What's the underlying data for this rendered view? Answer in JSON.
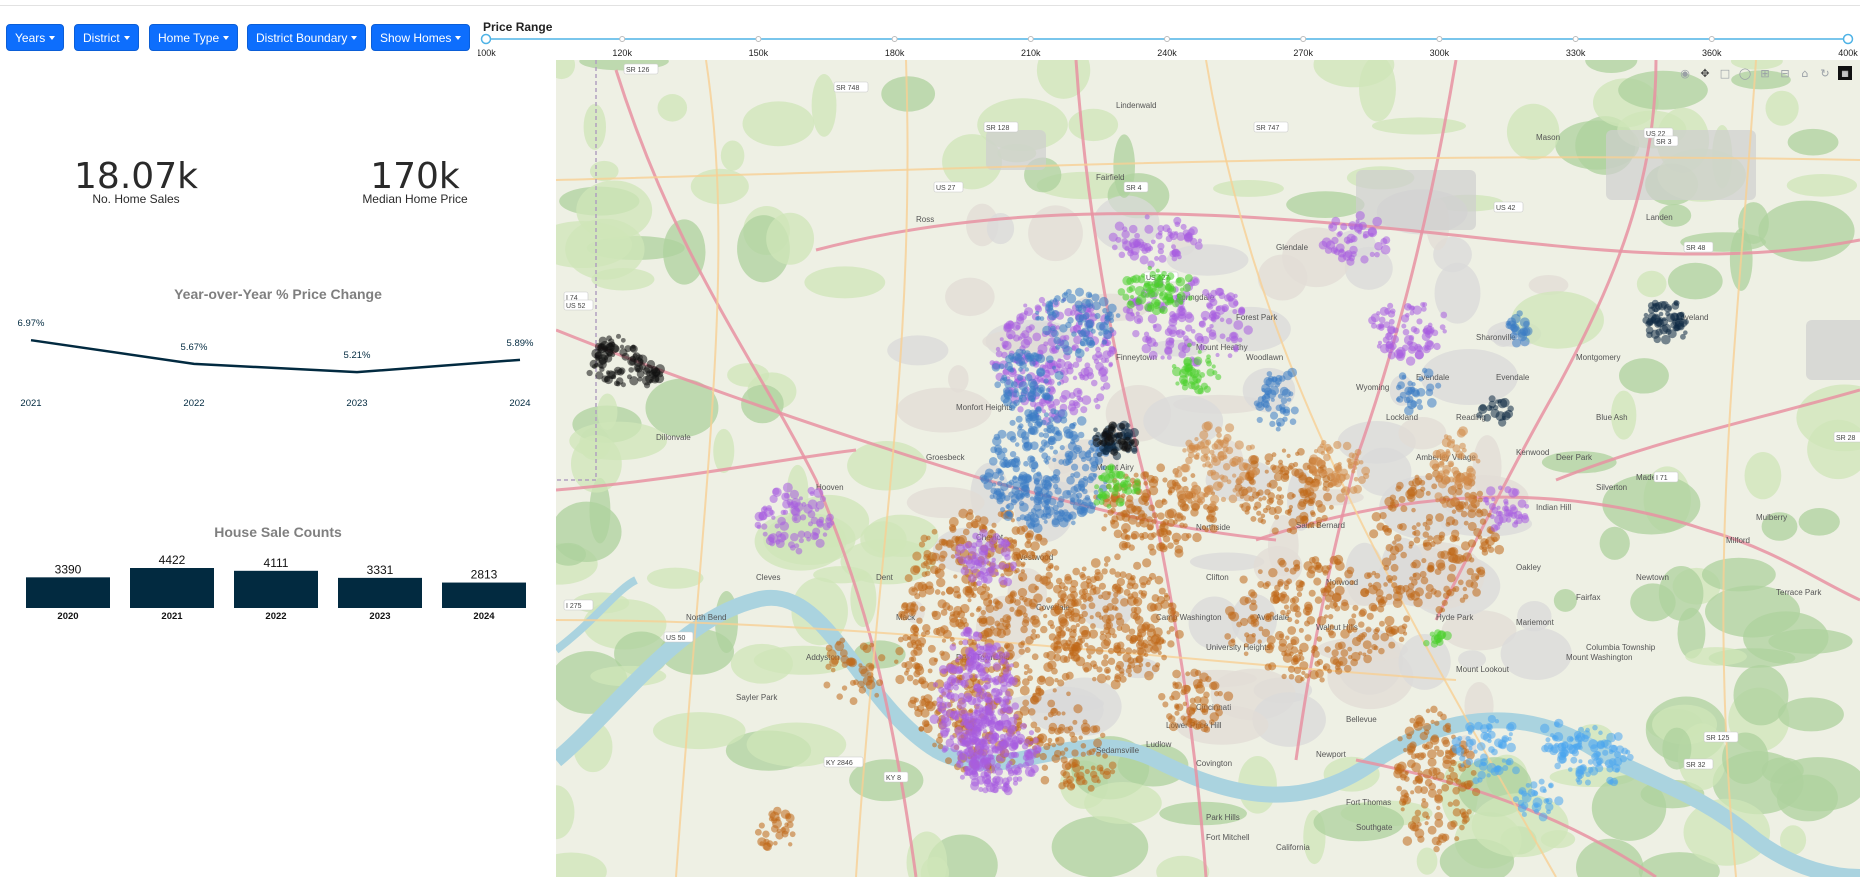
{
  "toolbar": {
    "filters": [
      {
        "label": "Years"
      },
      {
        "label": "District"
      },
      {
        "label": "Home Type"
      },
      {
        "label": "District Boundary"
      },
      {
        "label": "Show Homes"
      }
    ],
    "accent": "#0d6efd"
  },
  "price_range": {
    "title": "Price Range",
    "ticks": [
      "100k",
      "120k",
      "150k",
      "180k",
      "210k",
      "240k",
      "270k",
      "300k",
      "330k",
      "360k",
      "400k"
    ],
    "selected_min": "100k",
    "selected_max": "400k",
    "track_color": "#4fb3e6"
  },
  "kpis": {
    "home_sales_value": "18.07k",
    "home_sales_label": "No. Home Sales",
    "median_price_value": "170k",
    "median_price_label": "Median Home Price"
  },
  "charts": {
    "yoy_title": "Year-over-Year % Price Change",
    "counts_title": "House Sale Counts",
    "bar_color": "#022a40"
  },
  "chart_data": [
    {
      "type": "line",
      "title": "Year-over-Year % Price Change",
      "x": [
        "2021",
        "2022",
        "2023",
        "2024"
      ],
      "values": [
        6.97,
        5.67,
        5.21,
        5.89
      ],
      "labels": [
        "6.97%",
        "5.67%",
        "5.21%",
        "5.89%"
      ]
    },
    {
      "type": "bar",
      "title": "House Sale Counts",
      "categories": [
        "2020",
        "2021",
        "2022",
        "2023",
        "2024"
      ],
      "values": [
        3390,
        4422,
        4111,
        3331,
        2813
      ]
    }
  ],
  "map": {
    "place_labels": [
      "Fairfield",
      "Lindenwald",
      "Mason",
      "Ross",
      "Sharonville",
      "Evendale",
      "Amberley Village",
      "Kenwood",
      "Indian Hill",
      "Milford",
      "Terrace Park",
      "Norwood",
      "Saint Bernard",
      "University Heights",
      "Cincinnati",
      "Newport",
      "Covington",
      "Bellevue",
      "Ludlow",
      "Fort Thomas",
      "Mariemont",
      "Mount Lookout",
      "Sedamsville",
      "Lower Price Hill",
      "North Bend",
      "Cleves",
      "Hooven",
      "Park Hills",
      "Fort Mitchell",
      "Southgate",
      "California",
      "Mount Washington",
      "Wyoming",
      "Lockland",
      "Camp Washington",
      "Landen",
      "Loveland",
      "Silverton",
      "Mulberry",
      "Sayler Park",
      "Addyston",
      "Dent",
      "Mack",
      "Monfort Heights",
      "Groesbeck",
      "Springdale",
      "Forest Park",
      "Mount Healthy",
      "Finneytown",
      "Woodlawn",
      "Glendale",
      "Evendale",
      "Montgomery",
      "Blue Ash",
      "Reading",
      "Deer Park",
      "Madeira",
      "Newtown",
      "Fairfax",
      "Columbia Township",
      "Oakley",
      "Hyde Park",
      "Walnut Hills",
      "Avondale",
      "Clifton",
      "Northside",
      "Mount Airy",
      "Cheviot",
      "Westwood",
      "Delhi Township",
      "Covedale",
      "Dillonvale"
    ],
    "road_labels": [
      "SR 126",
      "SR 748",
      "SR 128",
      "US 27",
      "SR 747",
      "US 42",
      "SR 4",
      "US 127",
      "US 22",
      "SR 3",
      "SR 48",
      "I 74",
      "US 52",
      "I 275",
      "US 50",
      "KY 8",
      "KY 2846",
      "SR 125",
      "SR 32",
      "SR 28",
      "I 71"
    ],
    "toolbar_icons": [
      "camera-icon",
      "pan-icon",
      "box-select-icon",
      "lasso-icon",
      "zoom-in-icon",
      "zoom-out-icon",
      "home-icon",
      "reset-icon",
      "plotly-logo"
    ]
  }
}
